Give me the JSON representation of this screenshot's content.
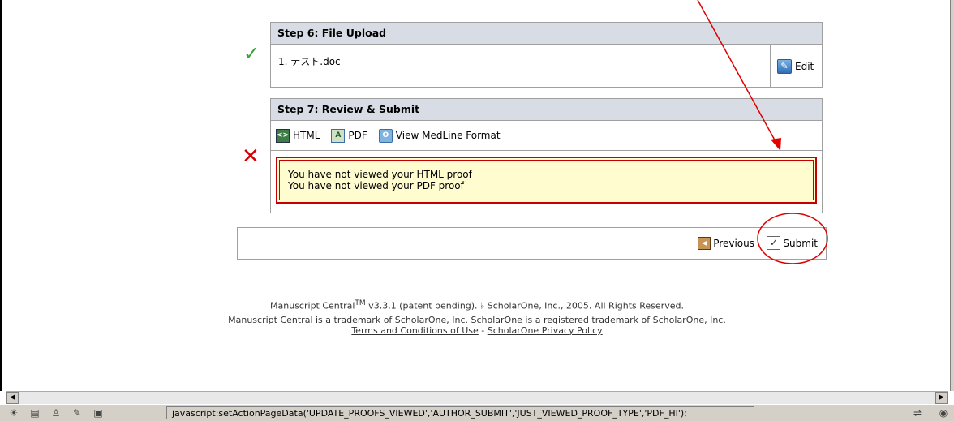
{
  "step6": {
    "header": "Step 6: File Upload",
    "file": "1.  テスト.doc",
    "edit_label": "Edit",
    "status_icon": "check-icon"
  },
  "step7": {
    "header": "Step 7: Review & Submit",
    "tools": [
      {
        "label": "HTML",
        "icon": "html-proof-icon",
        "glyph": "<>"
      },
      {
        "label": "PDF",
        "icon": "pdf-icon",
        "glyph": "A"
      },
      {
        "label": "View MedLine Format",
        "icon": "medline-icon",
        "glyph": "O"
      }
    ],
    "warnings": [
      "You have not viewed your HTML proof",
      "You have not viewed your PDF proof"
    ],
    "status_icon": "x-icon"
  },
  "actions": {
    "previous_label": "Previous",
    "submit_label": "Submit"
  },
  "footer": {
    "line1_a": "Manuscript Central",
    "tm": "TM",
    "line1_b": " v3.3.1 (patent pending). ♭ ScholarOne, Inc., 2005. All Rights Reserved.",
    "line2": "Manuscript Central is a trademark of ScholarOne, Inc. ScholarOne is a registered trademark of ScholarOne, Inc.",
    "terms_link": "Terms and Conditions of Use",
    "separator": " - ",
    "privacy_link": "ScholarOne Privacy Policy"
  },
  "statusbar": {
    "message": "javascript:setActionPageData('UPDATE_PROOFS_VIEWED','AUTHOR_SUBMIT','JUST_VIEWED_PROOF_TYPE','PDF_HI');"
  },
  "annotation_color": "#e00000"
}
